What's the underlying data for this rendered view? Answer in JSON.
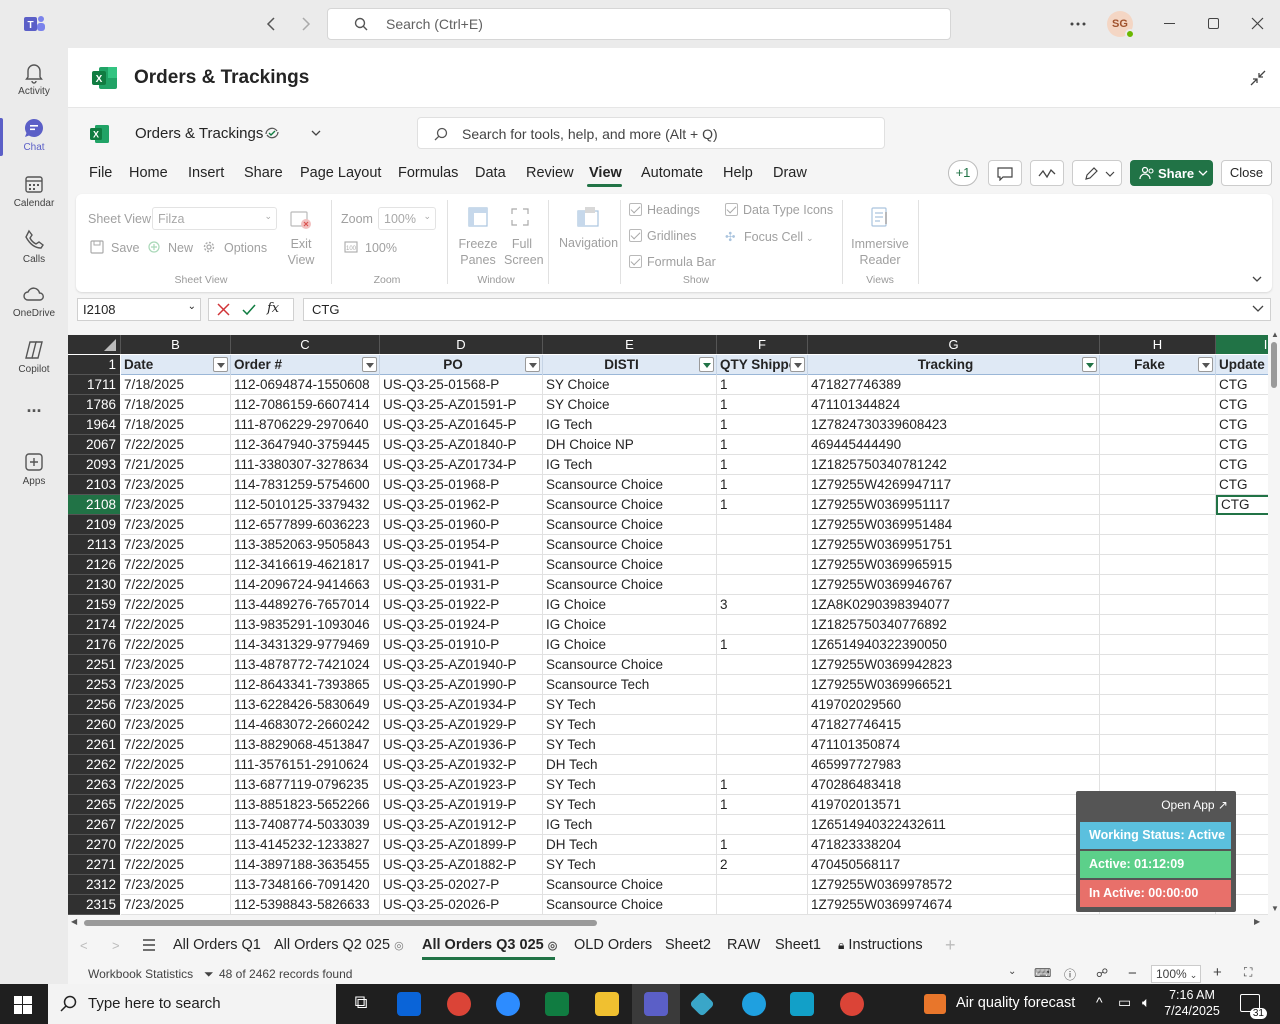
{
  "teams": {
    "search_placeholder": "Search (Ctrl+E)",
    "avatar_initials": "SG",
    "rail": [
      {
        "label": "Activity",
        "icon": "bell-icon"
      },
      {
        "label": "Chat",
        "icon": "chat-icon"
      },
      {
        "label": "Calendar",
        "icon": "calendar-icon"
      },
      {
        "label": "Calls",
        "icon": "phone-icon"
      },
      {
        "label": "OneDrive",
        "icon": "cloud-icon"
      },
      {
        "label": "Copilot",
        "icon": "copilot-icon"
      },
      {
        "label": "...",
        "icon": "more-icon"
      },
      {
        "label": "Apps",
        "icon": "apps-icon"
      }
    ]
  },
  "app": {
    "title": "Orders & Trackings",
    "doc_title": "Orders & Trackings",
    "tool_search_placeholder": "Search for tools, help, and more (Alt + Q)"
  },
  "menu": {
    "items": [
      "File",
      "Home",
      "Insert",
      "Share",
      "Page Layout",
      "Formulas",
      "Data",
      "Review",
      "View",
      "Automate",
      "Help",
      "Draw"
    ],
    "active": "View",
    "plus_one": "+1",
    "share_label": "Share",
    "close_label": "Close"
  },
  "ribbon": {
    "sheet_view_label": "Sheet View",
    "sheet_view_value": "Filza",
    "save": "Save",
    "new": "New",
    "options": "Options",
    "exit_view": "Exit View",
    "group_sheet_view": "Sheet View",
    "zoom_label": "Zoom",
    "zoom_value": "100%",
    "zoom_100": "100%",
    "group_zoom": "Zoom",
    "freeze_panes": "Freeze Panes",
    "full_screen": "Full Screen",
    "group_window": "Window",
    "navigation": "Navigation",
    "headings": "Headings",
    "gridlines": "Gridlines",
    "formula_bar": "Formula Bar",
    "data_type_icons": "Data Type Icons",
    "focus_cell": "Focus Cell",
    "group_show": "Show",
    "immersive_reader": "Immersive Reader",
    "group_views": "Views"
  },
  "formula": {
    "name_box": "I2108",
    "content": "CTG"
  },
  "sheet": {
    "col_letters": [
      "B",
      "C",
      "D",
      "E",
      "F",
      "G",
      "H",
      "I"
    ],
    "header_row_number": "1",
    "headers": [
      "Date",
      "Order #",
      "PO",
      "DISTI",
      "QTY Shipped",
      "Tracking",
      "Fake",
      "Update on Amazon"
    ],
    "rows": [
      [
        "1711",
        "7/18/2025",
        "112-0694874-1550608",
        "US-Q3-25-01568-P",
        "SY Choice",
        "1",
        "471827746389",
        "",
        "CTG"
      ],
      [
        "1786",
        "7/18/2025",
        "112-7086159-6607414",
        "US-Q3-25-AZ01591-P",
        "SY Choice",
        "1",
        "471101344824",
        "",
        "CTG"
      ],
      [
        "1964",
        "7/18/2025",
        "111-8706229-2970640",
        "US-Q3-25-AZ01645-P",
        "IG Tech",
        "1",
        "1Z7824730339608423",
        "",
        "CTG"
      ],
      [
        "2067",
        "7/22/2025",
        "112-3647940-3759445",
        "US-Q3-25-AZ01840-P",
        "DH Choice NP",
        "1",
        "469445444490",
        "",
        "CTG"
      ],
      [
        "2093",
        "7/21/2025",
        "111-3380307-3278634",
        "US-Q3-25-AZ01734-P",
        "IG Tech",
        "1",
        "1Z1825750340781242",
        "",
        "CTG"
      ],
      [
        "2103",
        "7/23/2025",
        "114-7831259-5754600",
        "US-Q3-25-01968-P",
        "Scansource Choice",
        "1",
        "1Z79255W4269947117",
        "",
        "CTG"
      ],
      [
        "2108",
        "7/23/2025",
        "112-5010125-3379432",
        "US-Q3-25-01962-P",
        "Scansource Choice",
        "1",
        "1Z79255W0369951117",
        "",
        "CTG"
      ],
      [
        "2109",
        "7/23/2025",
        "112-6577899-6036223",
        "US-Q3-25-01960-P",
        "Scansource Choice",
        "",
        "1Z79255W0369951484",
        "",
        ""
      ],
      [
        "2113",
        "7/23/2025",
        "113-3852063-9505843",
        "US-Q3-25-01954-P",
        "Scansource Choice",
        "",
        "1Z79255W0369951751",
        "",
        ""
      ],
      [
        "2126",
        "7/22/2025",
        "112-3416619-4621817",
        "US-Q3-25-01941-P",
        "Scansource Choice",
        "",
        "1Z79255W0369965915",
        "",
        ""
      ],
      [
        "2130",
        "7/22/2025",
        "114-2096724-9414663",
        "US-Q3-25-01931-P",
        "Scansource Choice",
        "",
        "1Z79255W0369946767",
        "",
        ""
      ],
      [
        "2159",
        "7/22/2025",
        "113-4489276-7657014",
        "US-Q3-25-01922-P",
        "IG Choice",
        "3",
        "1ZA8K0290398394077",
        "",
        ""
      ],
      [
        "2174",
        "7/22/2025",
        "113-9835291-1093046",
        "US-Q3-25-01924-P",
        "IG Choice",
        "",
        "1Z1825750340776892",
        "",
        ""
      ],
      [
        "2176",
        "7/22/2025",
        "114-3431329-9779469",
        "US-Q3-25-01910-P",
        "IG Choice",
        "1",
        "1Z6514940322390050",
        "",
        ""
      ],
      [
        "2251",
        "7/23/2025",
        "113-4878772-7421024",
        "US-Q3-25-AZ01940-P",
        "Scansource Choice",
        "",
        "1Z79255W0369942823",
        "",
        ""
      ],
      [
        "2253",
        "7/23/2025",
        "112-8643341-7393865",
        "US-Q3-25-AZ01990-P",
        "Scansource Tech",
        "",
        "1Z79255W0369966521",
        "",
        ""
      ],
      [
        "2256",
        "7/23/2025",
        "113-6228426-5830649",
        "US-Q3-25-AZ01934-P",
        "SY Tech",
        "",
        "419702029560",
        "",
        ""
      ],
      [
        "2260",
        "7/23/2025",
        "114-4683072-2660242",
        "US-Q3-25-AZ01929-P",
        "SY Tech",
        "",
        "471827746415",
        "",
        ""
      ],
      [
        "2261",
        "7/22/2025",
        "113-8829068-4513847",
        "US-Q3-25-AZ01936-P",
        "SY Tech",
        "",
        "471101350874",
        "",
        ""
      ],
      [
        "2262",
        "7/22/2025",
        "111-3576151-2910624",
        "US-Q3-25-AZ01932-P",
        "DH Tech",
        "",
        "465997727983",
        "",
        ""
      ],
      [
        "2263",
        "7/22/2025",
        "113-6877119-0796235",
        "US-Q3-25-AZ01923-P",
        "SY Tech",
        "1",
        "470286483418",
        "",
        ""
      ],
      [
        "2265",
        "7/22/2025",
        "113-8851823-5652266",
        "US-Q3-25-AZ01919-P",
        "SY Tech",
        "1",
        "419702013571",
        "",
        ""
      ],
      [
        "2267",
        "7/22/2025",
        "113-7408774-5033039",
        "US-Q3-25-AZ01912-P",
        "IG Tech",
        "",
        "1Z6514940322432611",
        "",
        ""
      ],
      [
        "2270",
        "7/22/2025",
        "113-4145232-1233827",
        "US-Q3-25-AZ01899-P",
        "DH Tech",
        "1",
        "471823338204",
        "",
        ""
      ],
      [
        "2271",
        "7/22/2025",
        "114-3897188-3635455",
        "US-Q3-25-AZ01882-P",
        "SY Tech",
        "2",
        "470450568117",
        "",
        ""
      ],
      [
        "2312",
        "7/23/2025",
        "113-7348166-7091420",
        "US-Q3-25-02027-P",
        "Scansource Choice",
        "",
        "1Z79255W0369978572",
        "",
        ""
      ],
      [
        "2315",
        "7/23/2025",
        "112-5398843-5826633",
        "US-Q3-25-02026-P",
        "Scansource Choice",
        "",
        "1Z79255W0369974674",
        "",
        ""
      ]
    ],
    "selected_row": "2108"
  },
  "popup": {
    "open_app": "Open App ↗",
    "status": "Working Status: Active",
    "active": "Active: 01:12:09",
    "inactive": "In Active: 00:00:00",
    "status_color": "#5bc0de",
    "active_color": "#5cd08a",
    "inactive_color": "#e8706a"
  },
  "tabs": {
    "items": [
      "All Orders Q1",
      "All Orders Q2 025",
      "All Orders Q3 025",
      "OLD Orders",
      "Sheet2",
      "RAW",
      "Sheet1",
      "Instructions"
    ],
    "active": "All Orders Q3 025"
  },
  "status": {
    "workbook_statistics": "Workbook Statistics",
    "records": "48 of 2462 records found",
    "zoom": "100%"
  },
  "taskbar": {
    "search_placeholder": "Type here to search",
    "weather": "Air quality forecast",
    "time": "7:16 AM",
    "date": "7/24/2025",
    "notifications": "31"
  },
  "colors": {
    "excel_green": "#217346",
    "teams_purple": "#5b5fc7"
  }
}
